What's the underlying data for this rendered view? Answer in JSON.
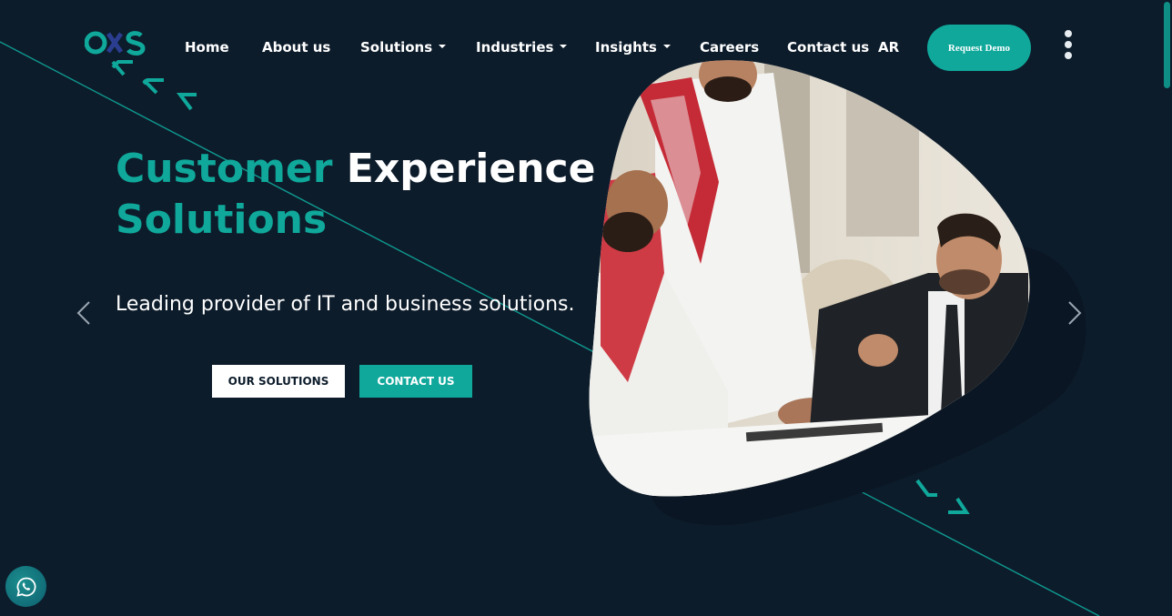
{
  "brand": {
    "logo_text": "CXS",
    "accent": "#0fa89b",
    "background": "#0d1c2b"
  },
  "nav": {
    "items": [
      {
        "label": "Home",
        "dropdown": false
      },
      {
        "label": "About us",
        "dropdown": false
      },
      {
        "label": "Solutions",
        "dropdown": true
      },
      {
        "label": "Industries",
        "dropdown": true
      },
      {
        "label": "Insights",
        "dropdown": true
      },
      {
        "label": "Careers",
        "dropdown": false
      },
      {
        "label": "Contact us",
        "dropdown": false
      }
    ],
    "lang": "AR",
    "demo_label": "Request Demo"
  },
  "hero": {
    "title_accent_1": "Customer",
    "title_white": "Experience",
    "title_accent_2": "Solutions",
    "subtitle": "Leading provider of IT and business solutions.",
    "btn_solutions": "OUR SOLUTIONS",
    "btn_contact": "CONTACT US"
  },
  "icons": {
    "whatsapp": "whatsapp-icon",
    "prev": "chevron-left-icon",
    "next": "chevron-right-icon",
    "menu": "kebab-menu-icon"
  }
}
